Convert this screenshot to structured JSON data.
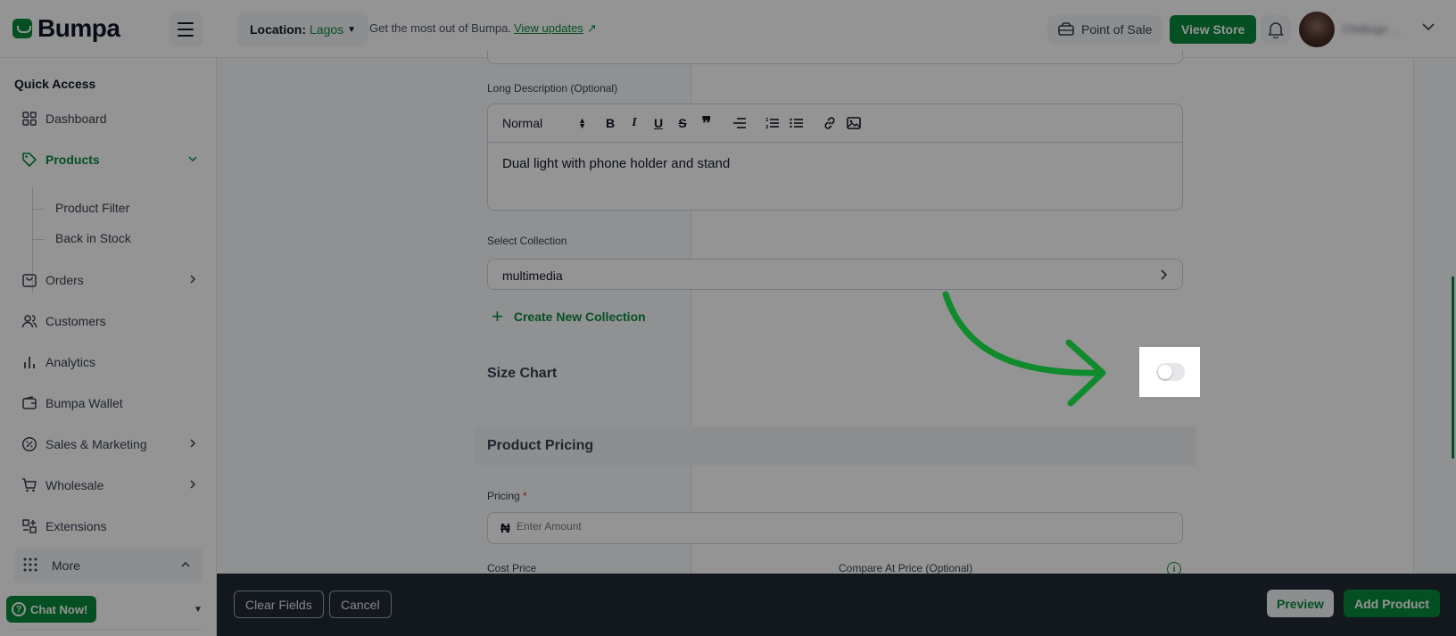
{
  "header": {
    "logo_text": "Bumpa",
    "location_label": "Location:",
    "location_value": "Lagos",
    "promo_text": "Get the most out of Bumpa.",
    "promo_link": "View updates",
    "pos_label": "Point of Sale",
    "view_store_label": "View Store",
    "user_name": "Chidiogo ...",
    "brand_color": "#0a8a3c"
  },
  "sidebar": {
    "section_title": "Quick Access",
    "items": [
      {
        "label": "Dashboard",
        "icon": "dashboard-icon"
      },
      {
        "label": "Products",
        "icon": "tag-icon"
      },
      {
        "label": "Orders",
        "icon": "bag-icon"
      },
      {
        "label": "Customers",
        "icon": "users-icon"
      },
      {
        "label": "Analytics",
        "icon": "bar-chart-icon"
      },
      {
        "label": "Bumpa Wallet",
        "icon": "wallet-icon"
      },
      {
        "label": "Sales & Marketing",
        "icon": "percent-icon"
      },
      {
        "label": "Wholesale",
        "icon": "cart-icon"
      },
      {
        "label": "Extensions",
        "icon": "puzzle-icon"
      }
    ],
    "sub_items": [
      "Product Filter",
      "Back in Stock"
    ],
    "more_label": "More",
    "chat_label": "Chat Now!"
  },
  "form": {
    "long_description_label": "Long Description (Optional)",
    "editor_format": "Normal",
    "editor_text": "Dual light with phone holder and stand",
    "select_collection_label": "Select Collection",
    "collection_value": "multimedia",
    "create_collection_label": "Create New Collection",
    "size_chart_label": "Size Chart",
    "size_chart_enabled": false,
    "pricing_section_title": "Product Pricing",
    "pricing_label": "Pricing",
    "required_mark": "*",
    "currency_symbol": "₦",
    "pricing_placeholder": "Enter Amount",
    "cost_price_label": "Cost Price",
    "compare_price_label": "Compare At Price (Optional)"
  },
  "footer": {
    "clear_label": "Clear Fields",
    "cancel_label": "Cancel",
    "preview_label": "Preview",
    "add_label": "Add Product"
  }
}
